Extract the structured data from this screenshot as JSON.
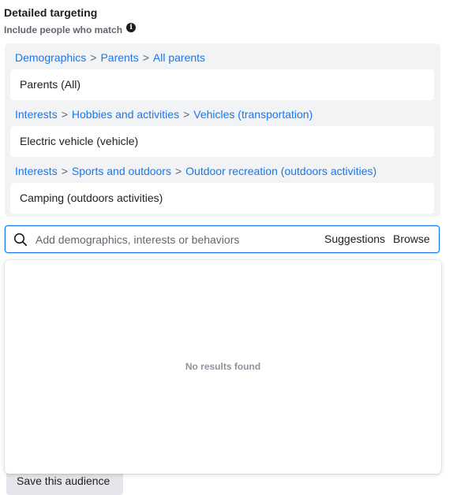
{
  "section": {
    "title": "Detailed targeting",
    "subtitle": "Include people who match"
  },
  "selections": [
    {
      "breadcrumb": [
        "Demographics",
        "Parents",
        "All parents"
      ],
      "item": "Parents (All)"
    },
    {
      "breadcrumb": [
        "Interests",
        "Hobbies and activities",
        "Vehicles (transportation)"
      ],
      "item": "Electric vehicle (vehicle)"
    },
    {
      "breadcrumb": [
        "Interests",
        "Sports and outdoors",
        "Outdoor recreation (outdoors activities)"
      ],
      "item": "Camping (outdoors activities)"
    }
  ],
  "breadcrumb_separator": ">",
  "search": {
    "placeholder": "Add demographics, interests or behaviors",
    "value": "",
    "suggestions_label": "Suggestions",
    "browse_label": "Browse"
  },
  "results": {
    "empty_message": "No results found"
  },
  "footer": {
    "save_audience_label": "Save this audience"
  },
  "colors": {
    "link": "#1877f2",
    "panel_bg": "#f2f3f5",
    "focus_border": "#1877f2"
  }
}
